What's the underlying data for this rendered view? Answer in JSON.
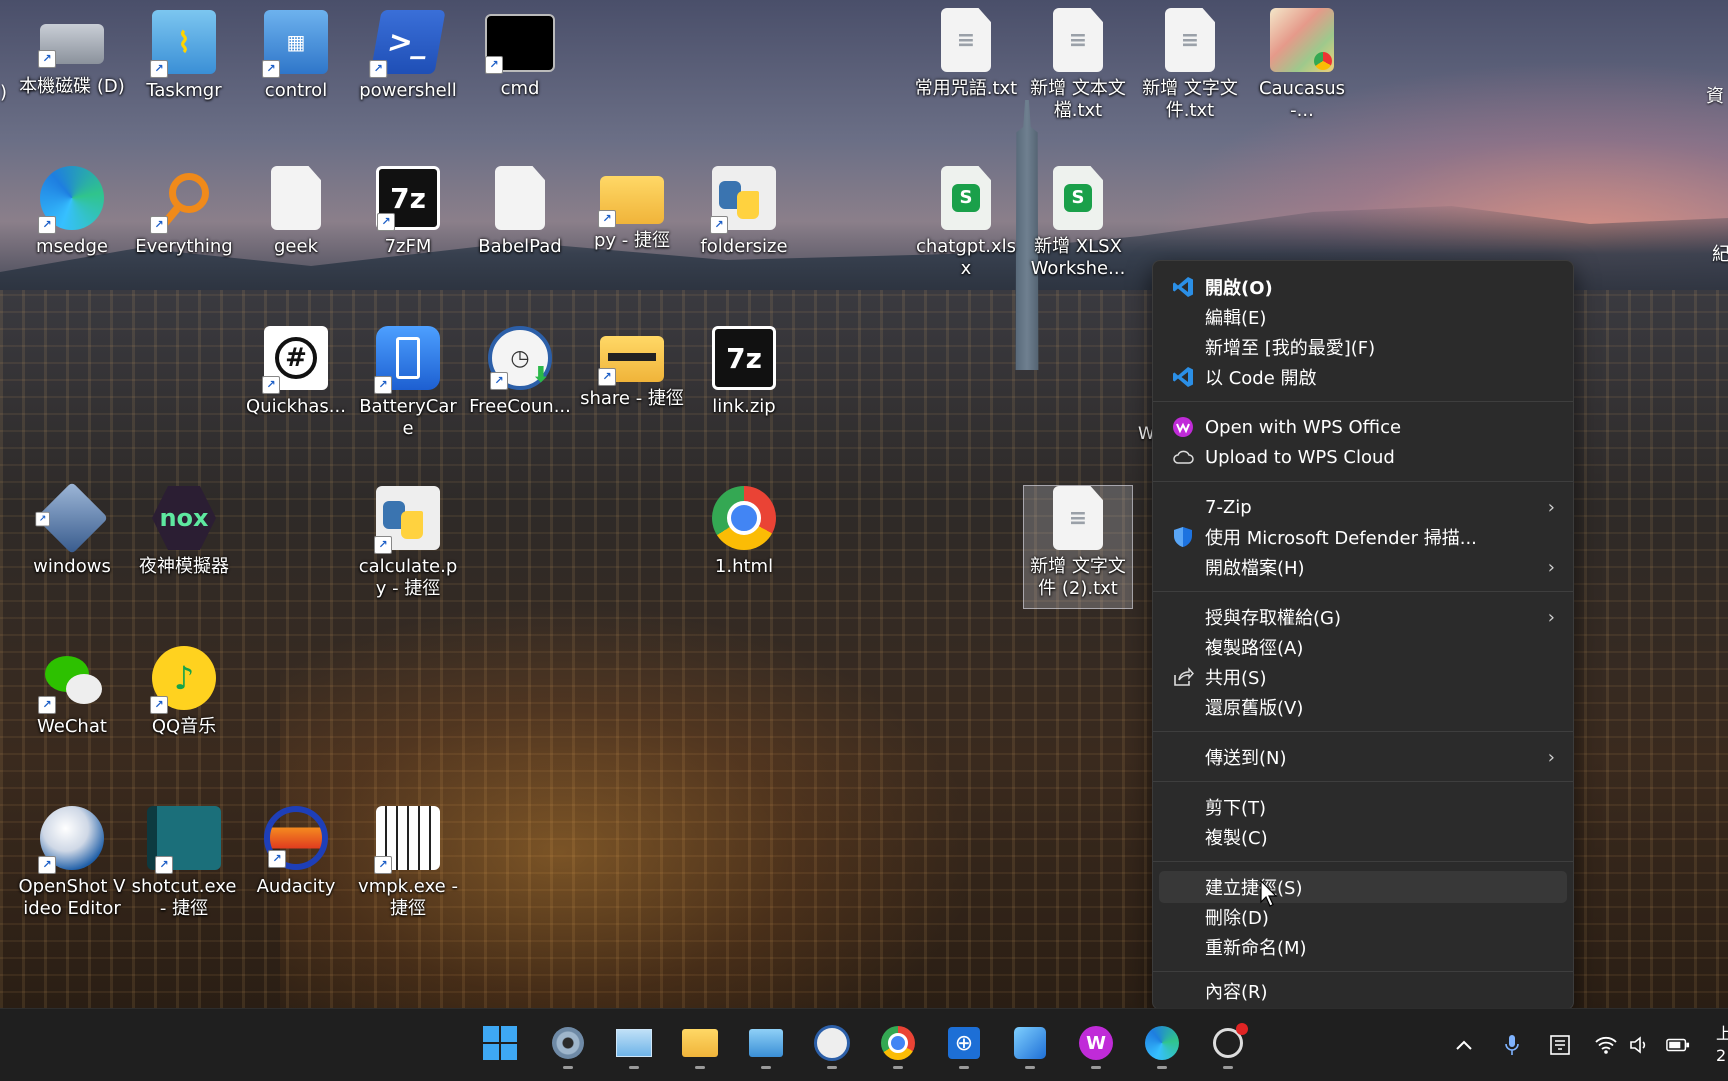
{
  "desktop": {
    "icons": [
      {
        "label": "本機磁碟 (D)",
        "icon": "drive-icon"
      },
      {
        "label": "Taskmgr",
        "icon": "task-manager-icon"
      },
      {
        "label": "control",
        "icon": "control-panel-icon"
      },
      {
        "label": "powershell",
        "icon": "powershell-icon"
      },
      {
        "label": "cmd",
        "icon": "cmd-icon"
      },
      {
        "label": "常用咒語.txt",
        "icon": "text-file-icon"
      },
      {
        "label": "新增 文本文檔.txt",
        "icon": "text-file-icon"
      },
      {
        "label": "新增 文字文件.txt",
        "icon": "text-file-icon"
      },
      {
        "label": "Caucasus-...",
        "icon": "map-file-icon"
      },
      {
        "label": "msedge",
        "icon": "edge-icon"
      },
      {
        "label": "Everything",
        "icon": "everything-search-icon"
      },
      {
        "label": "geek",
        "icon": "blank-file-icon"
      },
      {
        "label": "7zFM",
        "icon": "7zip-icon"
      },
      {
        "label": "BabelPad",
        "icon": "blank-file-icon"
      },
      {
        "label": "py - 捷徑",
        "icon": "folder-icon"
      },
      {
        "label": "foldersize",
        "icon": "python-icon"
      },
      {
        "label": "chatgpt.xlsx",
        "icon": "spreadsheet-icon"
      },
      {
        "label": "新增 XLSX Workshe...",
        "icon": "spreadsheet-icon"
      },
      {
        "label": "Quickhas...",
        "icon": "hash-magnifier-icon"
      },
      {
        "label": "BatteryCare",
        "icon": "battery-icon"
      },
      {
        "label": "FreeCoun...",
        "icon": "clock-icon"
      },
      {
        "label": "share - 捷徑",
        "icon": "folder-icon"
      },
      {
        "label": "link.zip",
        "icon": "7zip-icon"
      },
      {
        "label": "windows",
        "icon": "virtualbox-icon"
      },
      {
        "label": "夜神模擬器",
        "icon": "nox-icon"
      },
      {
        "label": "calculate.py - 捷徑",
        "icon": "python-icon"
      },
      {
        "label": "1.html",
        "icon": "chrome-icon"
      },
      {
        "label": "新增 文字文件 (2).txt",
        "icon": "text-file-icon"
      },
      {
        "label": "WeChat",
        "icon": "wechat-icon"
      },
      {
        "label": "QQ音乐",
        "icon": "qq-music-icon"
      },
      {
        "label": "OpenShot Video Editor",
        "icon": "openshot-icon"
      },
      {
        "label": "shotcut.exe - 捷徑",
        "icon": "shotcut-icon"
      },
      {
        "label": "Audacity",
        "icon": "audacity-icon"
      },
      {
        "label": "vmpk.exe - 捷徑",
        "icon": "piano-icon"
      }
    ],
    "edge_fragments": [
      ")",
      "資",
      "紀",
      "W"
    ]
  },
  "context_menu": {
    "items": [
      {
        "label": "開啟(O)",
        "icon": "vscode-icon",
        "bold": true
      },
      {
        "label": "編輯(E)",
        "icon": ""
      },
      {
        "label": "新增至 [我的最愛](F)",
        "icon": ""
      },
      {
        "label": "以 Code 開啟",
        "icon": "vscode-icon"
      },
      {
        "label": "Open with WPS Office",
        "icon": "wps-icon"
      },
      {
        "label": "Upload to WPS Cloud",
        "icon": "cloud-icon"
      },
      {
        "label": "7-Zip",
        "icon": "",
        "submenu": true
      },
      {
        "label": "使用 Microsoft Defender 掃描...",
        "icon": "defender-shield-icon"
      },
      {
        "label": "開啟檔案(H)",
        "icon": "",
        "submenu": true
      },
      {
        "label": "授與存取權給(G)",
        "icon": "",
        "submenu": true
      },
      {
        "label": "複製路徑(A)",
        "icon": ""
      },
      {
        "label": "共用(S)",
        "icon": "share-icon"
      },
      {
        "label": "還原舊版(V)",
        "icon": ""
      },
      {
        "label": "傳送到(N)",
        "icon": "",
        "submenu": true
      },
      {
        "label": "剪下(T)",
        "icon": ""
      },
      {
        "label": "複製(C)",
        "icon": ""
      },
      {
        "label": "建立捷徑(S)",
        "icon": "",
        "hovered": true
      },
      {
        "label": "刪除(D)",
        "icon": ""
      },
      {
        "label": "重新命名(M)",
        "icon": ""
      },
      {
        "label": "內容(R)",
        "icon": ""
      }
    ],
    "submenu_glyph": "›"
  },
  "taskbar": {
    "apps": [
      "windows-start-icon",
      "settings-icon",
      "task-manager-icon",
      "file-explorer-icon",
      "control-panel-icon",
      "clock-icon",
      "chrome-icon",
      "globe-network-icon",
      "photos-icon",
      "wps-icon",
      "edge-icon",
      "openai-icon"
    ],
    "tray": [
      "chevron-up-icon",
      "microphone-icon",
      "keyboard-layout-icon",
      "wifi-icon",
      "volume-icon",
      "battery-icon"
    ],
    "clock_fragment": [
      "上",
      "2"
    ]
  },
  "colors": {
    "menu_bg": "#2b2b2b",
    "menu_hover": "#383838",
    "taskbar_bg": "#1f1f1f",
    "vscode_blue": "#2b8fe6",
    "wps_magenta": "#c02bd8",
    "defender_blue": "#1d73e0"
  }
}
